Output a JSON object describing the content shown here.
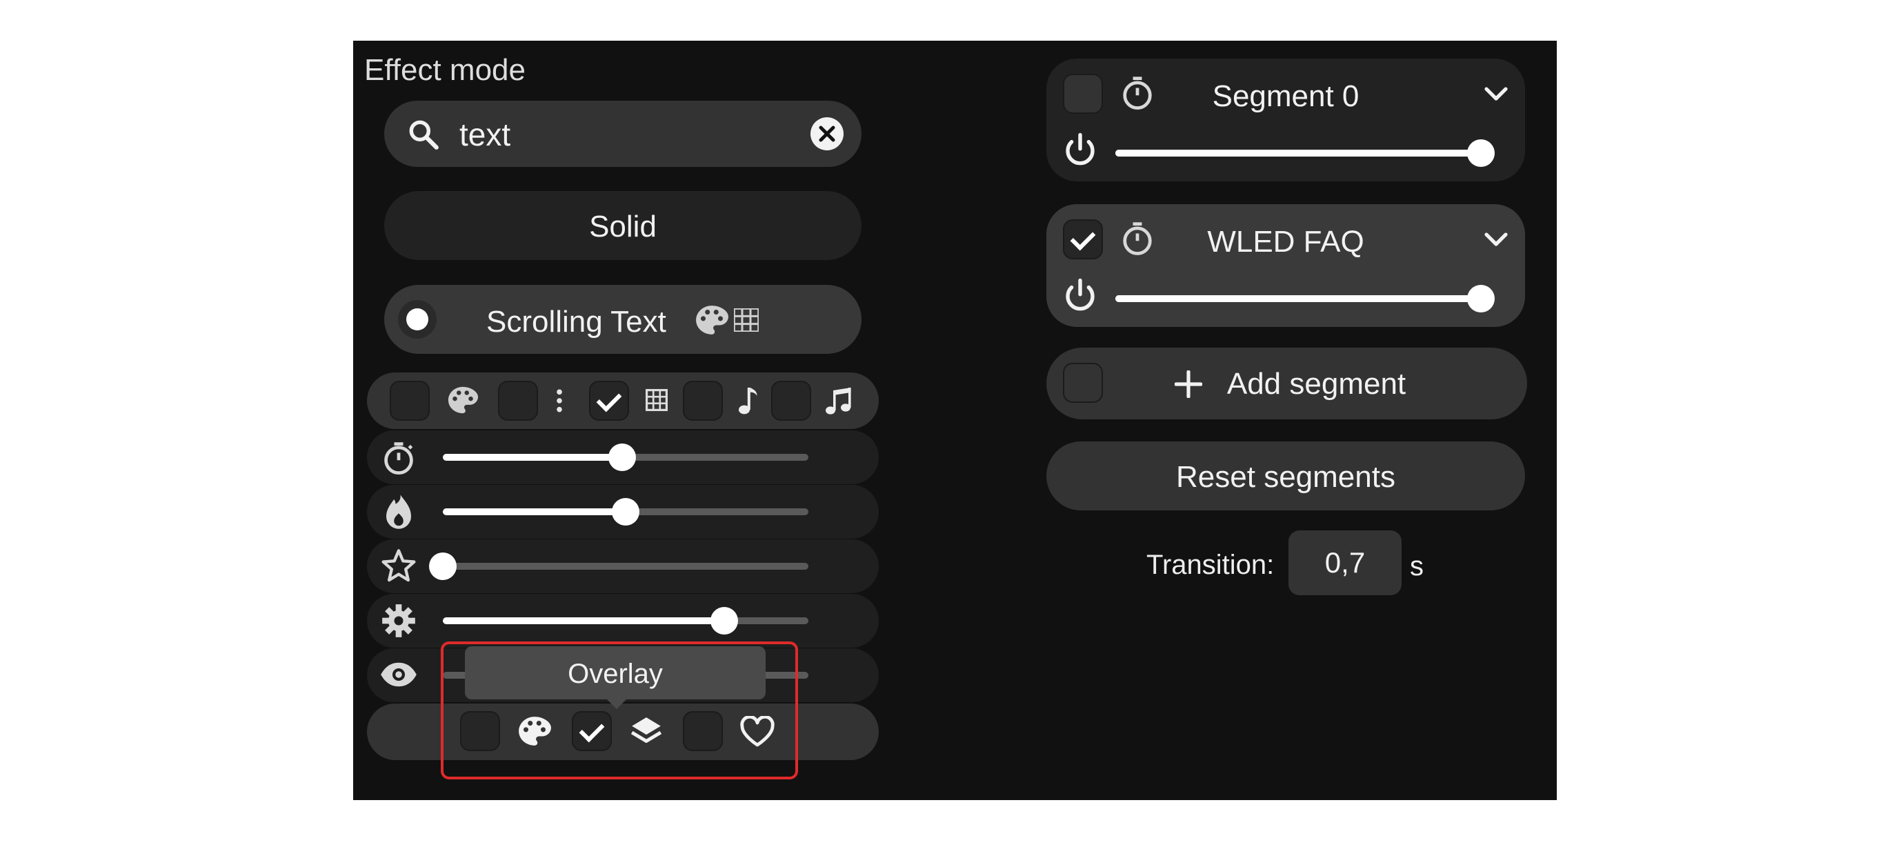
{
  "effect_panel": {
    "title": "Effect mode",
    "search": {
      "value": "text",
      "icon": "search-icon",
      "clear_icon": "clear-icon"
    },
    "effects": [
      {
        "label": "Solid",
        "selected": false
      },
      {
        "label": "Scrolling Text",
        "selected": true,
        "icons": [
          "palette-icon",
          "matrix-icon"
        ]
      }
    ],
    "filters": [
      {
        "icon": "palette-icon",
        "checked": false
      },
      {
        "icon": "more-vertical-icon",
        "checked": false
      },
      {
        "icon": "matrix-icon",
        "checked": true
      },
      {
        "icon": "music-note-icon",
        "checked": false
      },
      {
        "icon": "music-notes-icon",
        "checked": false
      }
    ],
    "sliders": [
      {
        "icon": "timer-icon",
        "value": 0.49
      },
      {
        "icon": "flame-icon",
        "value": 0.5
      },
      {
        "icon": "star-icon",
        "value": 0.0
      },
      {
        "icon": "gear-icon",
        "value": 0.77
      },
      {
        "icon": "eye-icon",
        "value": 0.0
      }
    ],
    "tooltip": "Overlay",
    "bottom_options": [
      {
        "icon": "palette-icon",
        "checked": false
      },
      {
        "icon": "layers-icon",
        "checked": true
      },
      {
        "icon": "heart-icon",
        "checked": false
      }
    ]
  },
  "segments_panel": {
    "segments": [
      {
        "name": "Segment 0",
        "checked": false,
        "brightness": 1.0
      },
      {
        "name": "WLED FAQ",
        "checked": true,
        "brightness": 1.0
      }
    ],
    "add_segment_label": "Add segment",
    "reset_segments_label": "Reset segments",
    "transition": {
      "label": "Transition:",
      "value": "0,7",
      "unit": "s"
    }
  }
}
